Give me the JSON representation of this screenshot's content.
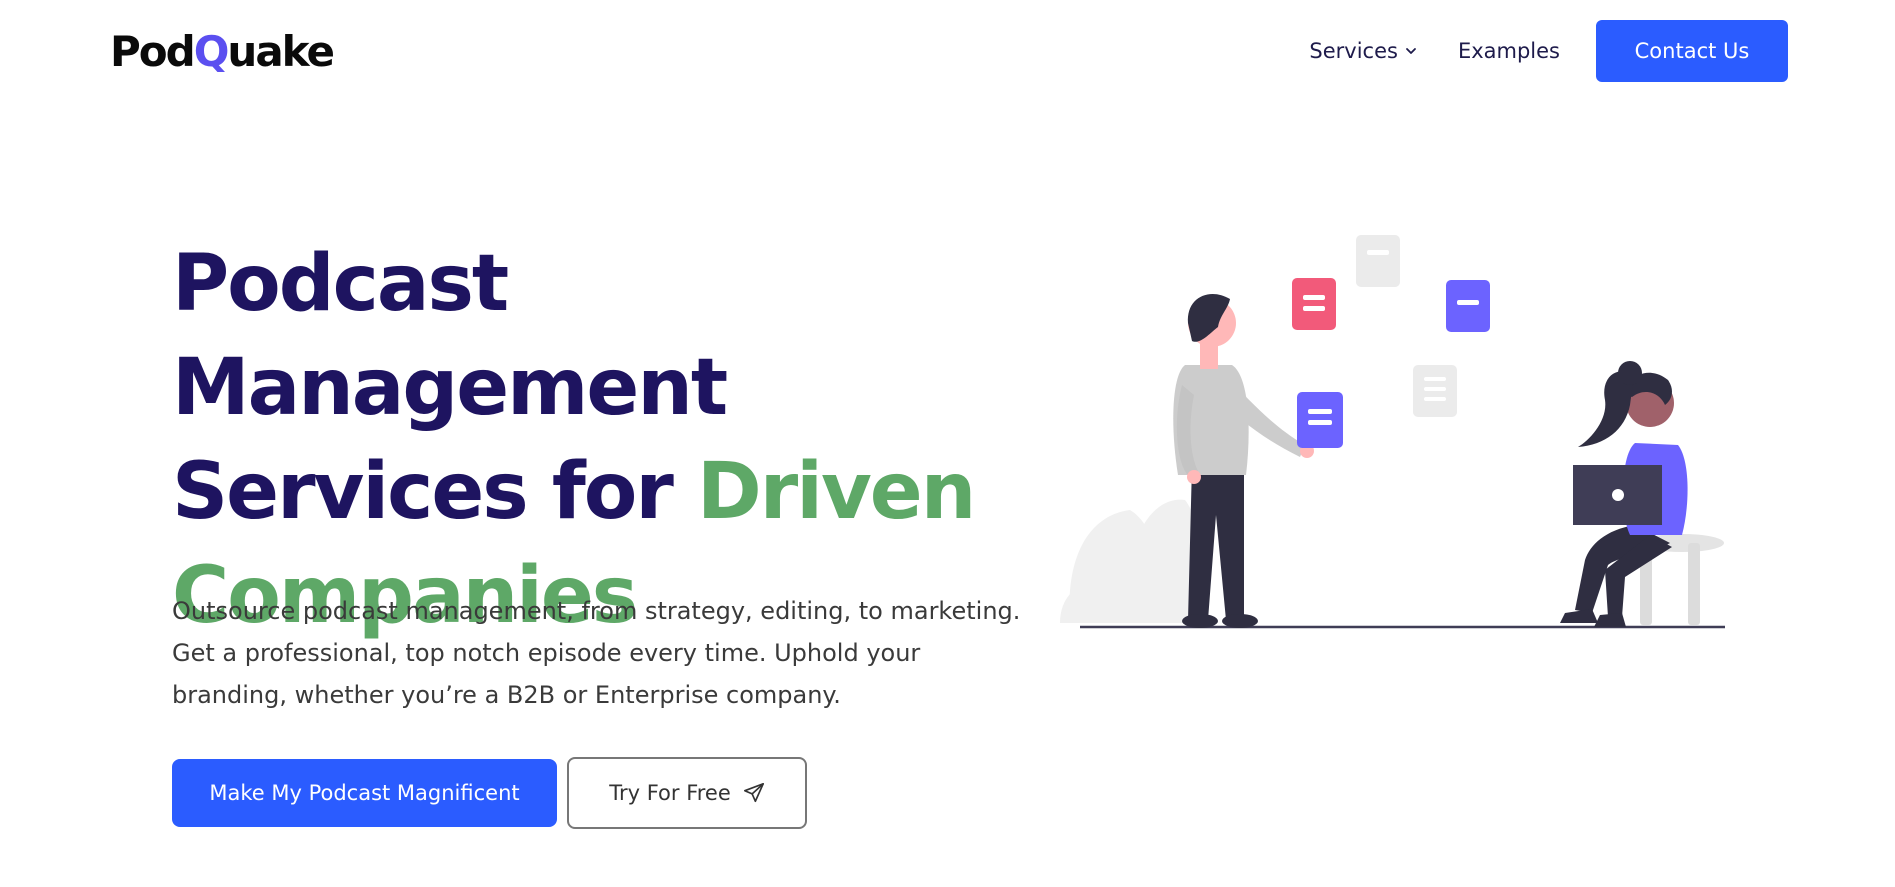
{
  "header": {
    "logo": {
      "part1": "Pod",
      "q": "Q",
      "part2": "uake"
    },
    "nav": {
      "services_label": "Services",
      "examples_label": "Examples",
      "contact_label": "Contact Us"
    }
  },
  "hero": {
    "title_line1": "Podcast Management",
    "title_line2_plain": "Services for ",
    "title_line2_accent": "Driven",
    "title_line3_accent": "Companies",
    "description": "Outsource podcast management, from strategy, editing, to marketing. Get a professional, top notch episode every time. Uphold your branding, whether you’re a B2B or Enterprise company.",
    "primary_cta": "Make My Podcast Magnificent",
    "secondary_cta": "Try For Free"
  },
  "icons": {
    "services_dropdown": "chevron-down-icon",
    "secondary_cta": "send-icon"
  },
  "colors": {
    "brand_blue": "#2b5cff",
    "heading_navy": "#1e1460",
    "accent_green": "#5ea867",
    "logo_q": "#5b4ff0"
  }
}
